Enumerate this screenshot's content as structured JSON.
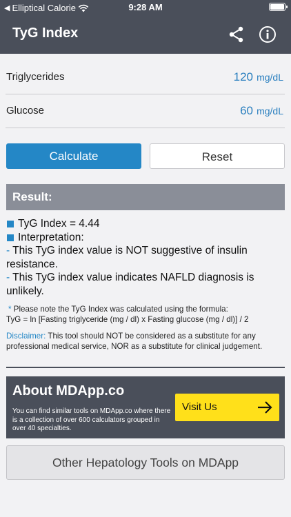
{
  "status_bar": {
    "carrier": "Elliptical Calorie",
    "time": "9:28 AM"
  },
  "nav": {
    "title": "TyG Index",
    "icons": [
      "share-icon",
      "info-icon"
    ]
  },
  "fields": {
    "triglycerides": {
      "label": "Triglycerides",
      "value": "120",
      "unit": "mg/dL"
    },
    "glucose": {
      "label": "Glucose",
      "value": "60",
      "unit": "mg/dL"
    }
  },
  "buttons": {
    "calculate": "Calculate",
    "reset": "Reset"
  },
  "result": {
    "header": "Result:",
    "index_line": "TyG Index = 4.44",
    "interpretation_label": "Interpretation:",
    "interpretations": [
      "This TyG index value is NOT suggestive of insulin resistance.",
      "This TyG index value indicates NAFLD diagnosis is unlikely."
    ],
    "formula_note_prefix": "*",
    "formula_note": "Please note the TyG Index was calculated using the formula:",
    "formula": "TyG = ln [Fasting triglyceride (mg / dl) x Fasting glucose (mg / dl)] / 2",
    "disclaimer_label": "Disclaimer:",
    "disclaimer_text": "This tool should NOT be considered as a substitute for any professional medical service, NOR as a substitute for clinical judgement."
  },
  "about": {
    "title": "About MDApp.co",
    "text": "You can find similar tools on MDApp.co where there is a collection of over 600 calculators grouped in over 40 specialties.",
    "visit_label": "Visit Us"
  },
  "other_tools": {
    "label": "Other Hepatology Tools on MDApp"
  },
  "colors": {
    "header_bg": "#4a4f5a",
    "accent": "#2487c6",
    "result_header": "#8a8e98",
    "visit_button": "#ffe01a"
  }
}
